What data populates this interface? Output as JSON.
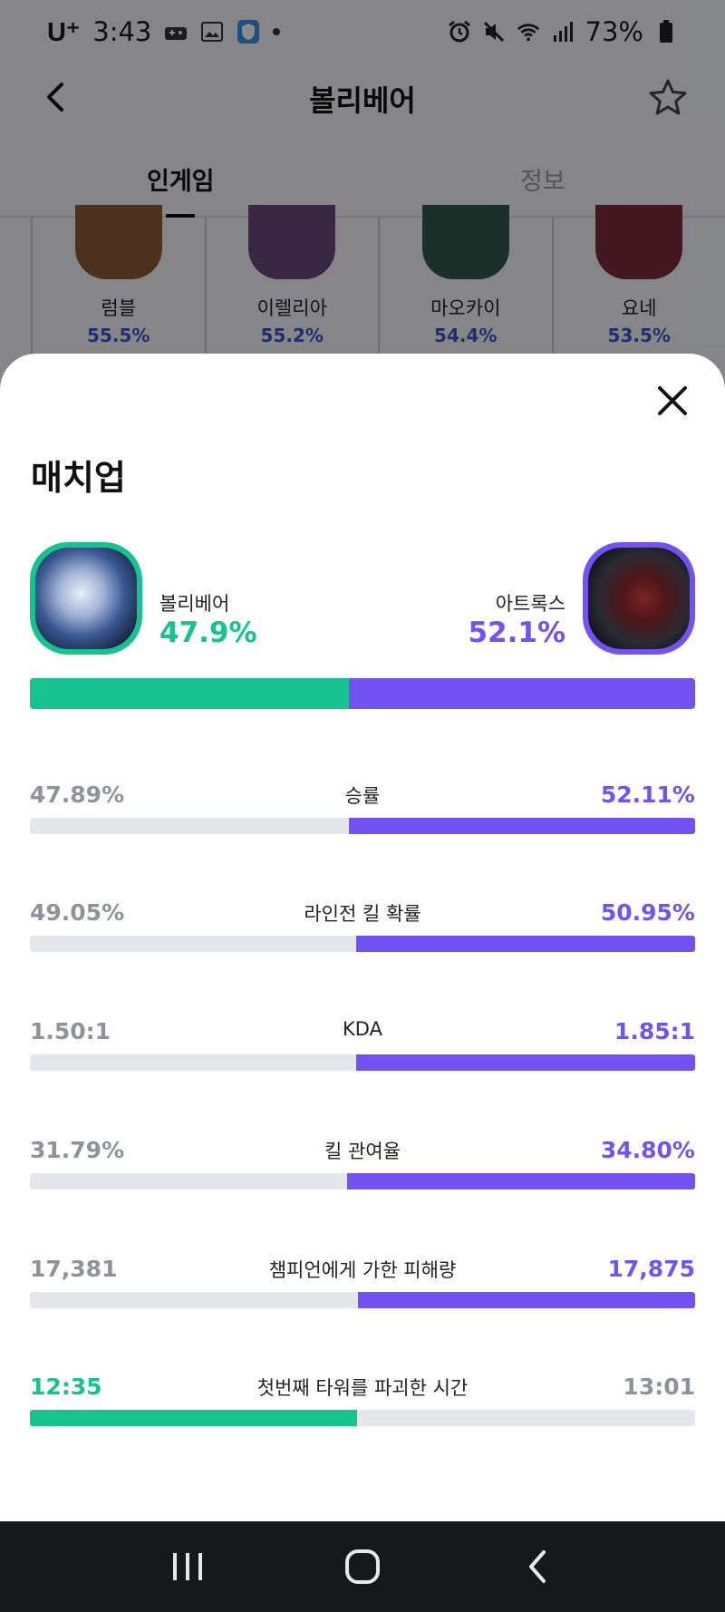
{
  "status_bar": {
    "carrier": "U⁺",
    "time": "3:43",
    "battery": "73%"
  },
  "app_bar": {
    "title": "볼리베어"
  },
  "tabs": [
    {
      "label": "인게임",
      "active": true
    },
    {
      "label": "정보",
      "active": false
    }
  ],
  "champion_list": [
    {
      "name": "럼블",
      "rate": "55.5%",
      "color": "#8a5a3a"
    },
    {
      "name": "이렐리아",
      "rate": "55.2%",
      "color": "#6b4a7a"
    },
    {
      "name": "마오카이",
      "rate": "54.4%",
      "color": "#2f5a4a"
    },
    {
      "name": "요네",
      "rate": "53.5%",
      "color": "#7a2a3a"
    }
  ],
  "sheet": {
    "title": "매치업",
    "left_champion": {
      "name": "볼리베어",
      "win_rate": "47.9%",
      "win_share": 0.479
    },
    "right_champion": {
      "name": "아트록스",
      "win_rate": "52.1%",
      "win_share": 0.521
    }
  },
  "stats": [
    {
      "label": "승률",
      "left": "47.89%",
      "right": "52.11%",
      "left_share": 0.4789,
      "winner": "right"
    },
    {
      "label": "라인전 킬 확률",
      "left": "49.05%",
      "right": "50.95%",
      "left_share": 0.4905,
      "winner": "right"
    },
    {
      "label": "KDA",
      "left": "1.50:1",
      "right": "1.85:1",
      "left_share": 0.4905,
      "winner": "right"
    },
    {
      "label": "킬 관여율",
      "left": "31.79%",
      "right": "34.80%",
      "left_share": 0.4774,
      "winner": "right"
    },
    {
      "label": "챔피언에게 가한 피해량",
      "left": "17,381",
      "right": "17,875",
      "left_share": 0.493,
      "winner": "right"
    },
    {
      "label": "첫번째 타워를 파괴한 시간",
      "left": "12:35",
      "right": "13:01",
      "left_share": 0.4918,
      "winner": "left"
    }
  ],
  "colors": {
    "green": "#14c38e",
    "purple": "#7352f4",
    "link_blue": "#3d55c8"
  },
  "icons": {
    "back": "chevron-left-icon",
    "favorite": "star-outline-icon",
    "close": "close-icon",
    "nav_recent": "recent-apps-icon",
    "nav_home": "home-icon",
    "nav_back": "nav-back-icon"
  }
}
